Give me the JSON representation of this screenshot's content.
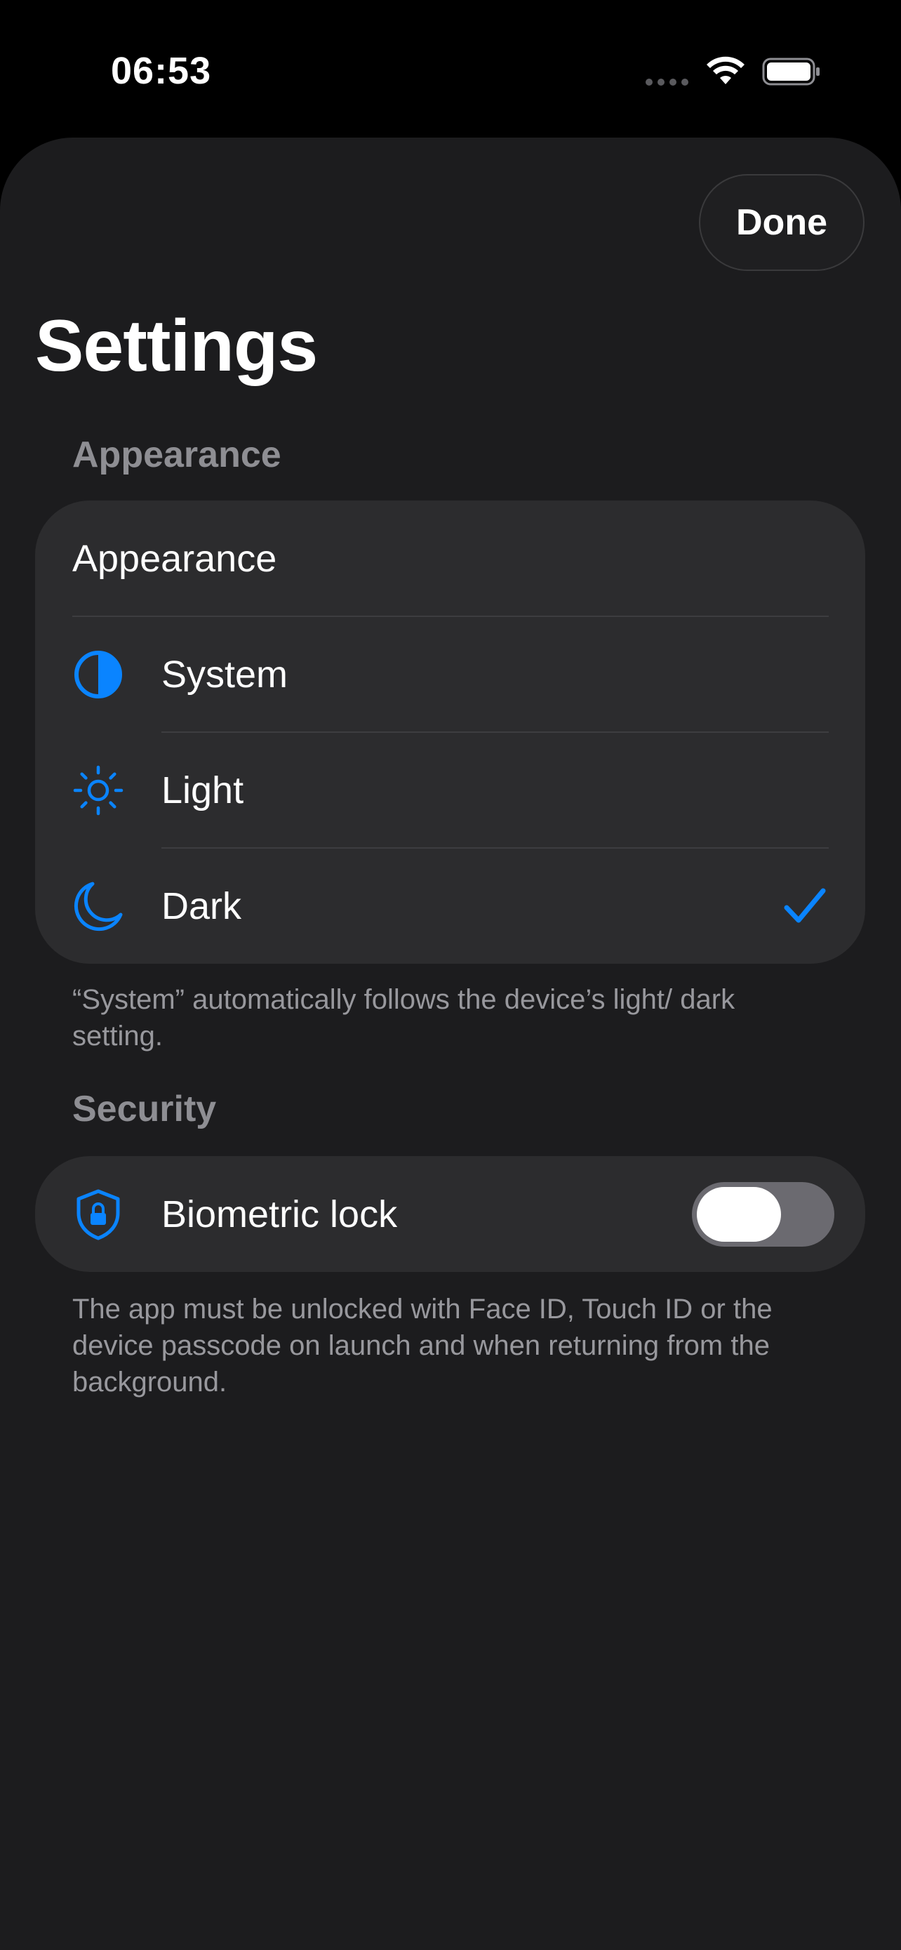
{
  "status_bar": {
    "time": "06:53"
  },
  "header": {
    "done_label": "Done",
    "title": "Settings"
  },
  "appearance_section": {
    "header": "Appearance",
    "card_title": "Appearance",
    "options": [
      {
        "label": "System",
        "icon": "half-circle-icon"
      },
      {
        "label": "Light",
        "icon": "sun-icon"
      },
      {
        "label": "Dark",
        "icon": "moon-icon"
      }
    ],
    "selected": "Dark",
    "footer": "“System” automatically follows the device’s light/ dark setting."
  },
  "security_section": {
    "header": "Security",
    "biometric_label": "Biometric lock",
    "biometric_icon": "shield-lock-icon",
    "biometric_enabled": false,
    "footer": "The app must be unlocked with Face ID, Touch ID or the device passcode on launch and when returning from the background."
  },
  "colors": {
    "accent": "#0a84ff",
    "background": "#1c1c1e",
    "card": "#2c2c2e",
    "secondary_text": "#8e8e93"
  }
}
